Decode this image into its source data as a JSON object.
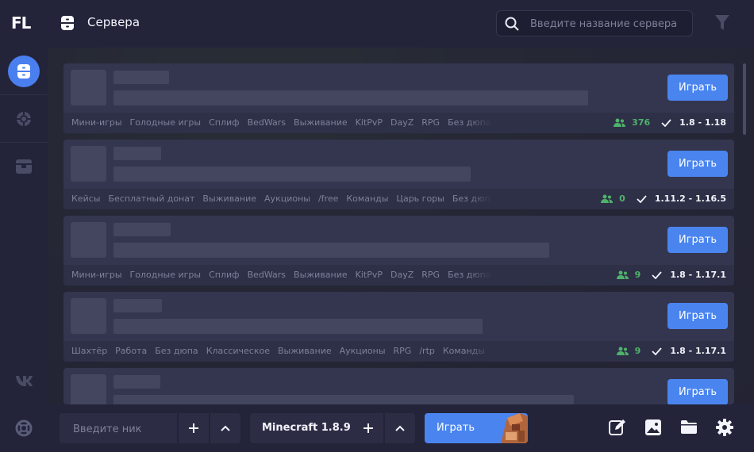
{
  "app": {
    "logo": "FL"
  },
  "header": {
    "title": "Сервера",
    "search_placeholder": "Введите название сервера"
  },
  "servers": [
    {
      "tags": [
        "Мини-игры",
        "Голодные игры",
        "Сплиф",
        "BedWars",
        "Выживание",
        "KitPvP",
        "DayZ",
        "RPG",
        "Без дюпа"
      ],
      "players": "376",
      "version": "1.8 - 1.18"
    },
    {
      "tags": [
        "Кейсы",
        "Бесплатный донат",
        "Выживание",
        "Аукционы",
        "/free",
        "Команды",
        "Царь горы",
        "Без дюпа"
      ],
      "players": "0",
      "version": "1.11.2 - 1.16.5"
    },
    {
      "tags": [
        "Мини-игры",
        "Голодные игры",
        "Сплиф",
        "BedWars",
        "Выживание",
        "KitPvP",
        "DayZ",
        "RPG",
        "Без дюпа"
      ],
      "players": "9",
      "version": "1.8 - 1.17.1"
    },
    {
      "tags": [
        "Шахтёр",
        "Работа",
        "Без дюпа",
        "Классическое",
        "Выживание",
        "Аукционы",
        "RPG",
        "/rtp",
        "Команды"
      ],
      "players": "9",
      "version": "1.8 - 1.17.1"
    },
    {
      "tags": [],
      "players": "",
      "version": ""
    }
  ],
  "card_play_label": "Играть",
  "bottom": {
    "nick_placeholder": "Введите ник",
    "version_label": "Minecraft 1.8.9",
    "play_label": "Играть"
  },
  "colors": {
    "accent": "#4a85ef",
    "players": "#4fb26a",
    "background": "#23243a",
    "card": "#34364f"
  },
  "icons": [
    "server-icon",
    "crosshair-icon",
    "box-icon",
    "vk-icon",
    "lifebuoy-icon",
    "search-icon",
    "filter-icon",
    "users-icon",
    "check-icon",
    "plus-icon",
    "chevron-up-icon",
    "edit-icon",
    "image-icon",
    "folder-icon",
    "gear-icon"
  ]
}
